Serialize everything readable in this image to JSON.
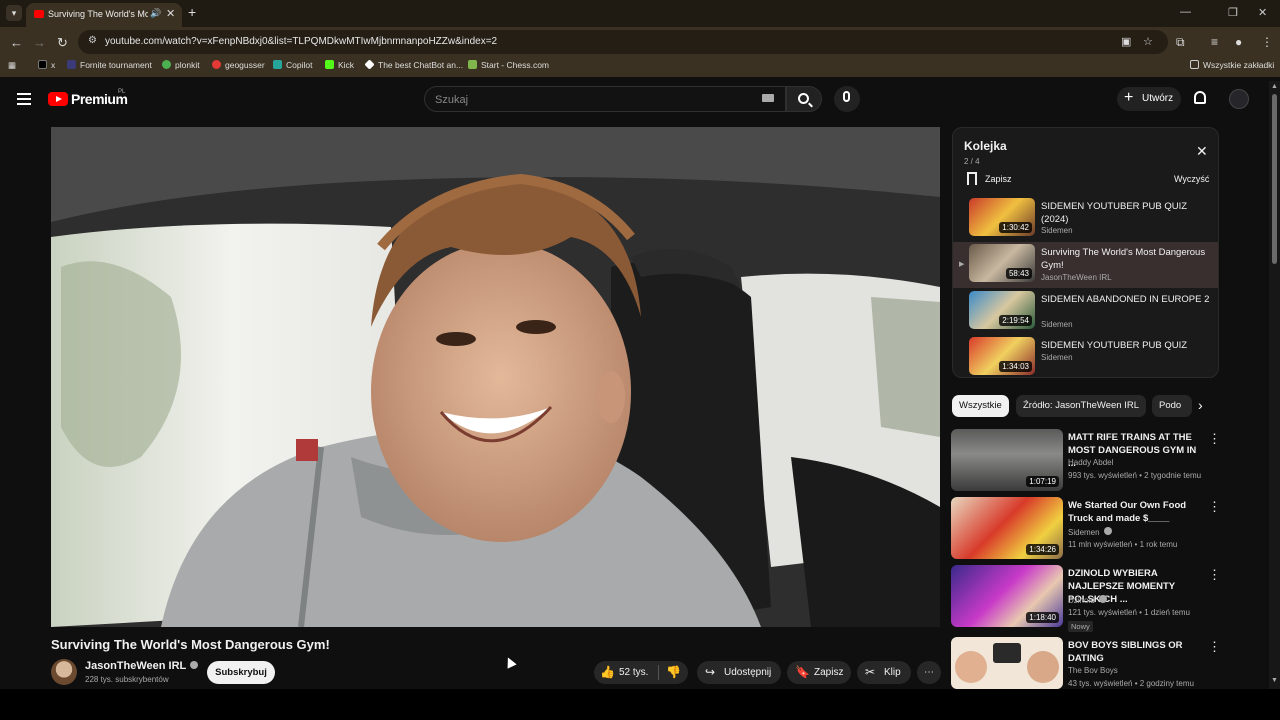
{
  "browser": {
    "tab_title": "Surviving The World's Most",
    "url": "youtube.com/watch?v=xFenpNBdxj0&list=TLPQMDkwMTIwMjbnmnanpoHZZw&index=2",
    "bookmarks": [
      {
        "label": "x",
        "color": "#000000"
      },
      {
        "label": "Fornite tournament",
        "color": "#3b3b7a"
      },
      {
        "label": "plonkit",
        "color": "#4caf50"
      },
      {
        "label": "geogusser",
        "color": "#e53935"
      },
      {
        "label": "Copilot",
        "color": "#26a69a"
      },
      {
        "label": "Kick",
        "color": "#53fc18"
      },
      {
        "label": "The best ChatBot an...",
        "color": "#ffffff"
      },
      {
        "label": "Start - Chess.com",
        "color": "#81b64c"
      }
    ],
    "bookmarks_all": "Wszystkie zakładki"
  },
  "header": {
    "brand": "Premium",
    "country": "PL",
    "search_placeholder": "Szukaj",
    "create_label": "Utwórz"
  },
  "video": {
    "title": "Surviving The World's Most Dangerous Gym!",
    "channel": "JasonTheWeen IRL",
    "subscribers": "228 tys. subskrybentów",
    "subscribe_label": "Subskrybuj",
    "likes": "52 tys.",
    "share_label": "Udostępnij",
    "save_label": "Zapisz",
    "clip_label": "Klip"
  },
  "queue": {
    "title": "Kolejka",
    "position": "2 / 4",
    "save_label": "Zapisz",
    "clear_label": "Wyczyść",
    "items": [
      {
        "title": "SIDEMEN YOUTUBER PUB QUIZ (2024)",
        "channel": "Sidemen",
        "duration": "1:30:42",
        "active": false
      },
      {
        "title": "Surviving The World's Most Dangerous Gym!",
        "channel": "JasonTheWeen IRL",
        "duration": "58:43",
        "active": true
      },
      {
        "title": "SIDEMEN ABANDONED IN EUROPE 2",
        "channel": "Sidemen",
        "duration": "2:19:54",
        "active": false
      },
      {
        "title": "SIDEMEN YOUTUBER PUB QUIZ",
        "channel": "Sidemen",
        "duration": "1:34:03",
        "active": false
      }
    ]
  },
  "chips": [
    "Wszystkie",
    "Źródło: JasonTheWeen IRL",
    "Podo"
  ],
  "recommendations": [
    {
      "title": "MATT RIFE TRAINS AT THE MOST DANGEROUS GYM IN ...",
      "channel": "Haddy Abdel",
      "meta": "993 tys. wyświetleń • 2 tygodnie temu",
      "duration": "1:07:19",
      "badge": ""
    },
    {
      "title": "We Started Our Own Food Truck and made $____",
      "channel": "Sidemen",
      "meta": "11 mln wyświetleń • 1 rok temu",
      "duration": "1:34:26",
      "badge": ""
    },
    {
      "title": "DZINOLD WYBIERA NAJLEPSZE MOMENTY POLSKICH ...",
      "channel": "Dzinold",
      "meta": "121 tys. wyświetleń • 1 dzień temu",
      "duration": "1:18:40",
      "badge": "Nowy"
    },
    {
      "title": "BOV BOYS SIBLINGS OR DATING",
      "channel": "The Bov Boys",
      "meta": "43 tys. wyświetleń • 2 godziny temu",
      "duration": "",
      "badge": ""
    }
  ],
  "colors": {
    "accent": "#ff0000",
    "background": "#0f0f0f",
    "browser_chrome": "#3a3122"
  }
}
